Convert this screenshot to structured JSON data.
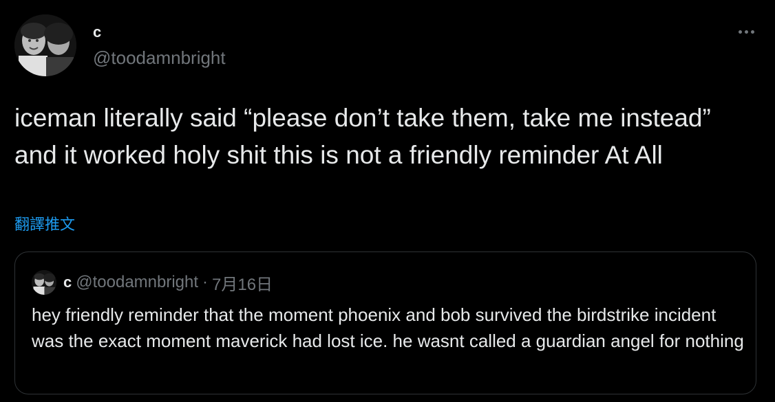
{
  "author": {
    "display_name": "c",
    "handle": "@toodamnbright",
    "avatar_icon": "profile-photo"
  },
  "more_icon": "more-horizontal-icon",
  "tweet": {
    "text": "iceman literally said “please don’t take them, take me instead” and it worked holy shit this is not a friendly reminder At All",
    "translate_label": "翻譯推文"
  },
  "quoted_tweet": {
    "display_name": "c",
    "handle": "@toodamnbright",
    "separator": "·",
    "date": "7月16日",
    "text": "hey friendly reminder that the moment phoenix and bob survived the birdstrike incident was the exact moment maverick had lost ice. he wasnt called a guardian angel for nothing"
  },
  "colors": {
    "background": "#000000",
    "primary_text": "#e7e9ea",
    "secondary_text": "#71767b",
    "link": "#1d9bf0",
    "border": "#2f3336"
  }
}
